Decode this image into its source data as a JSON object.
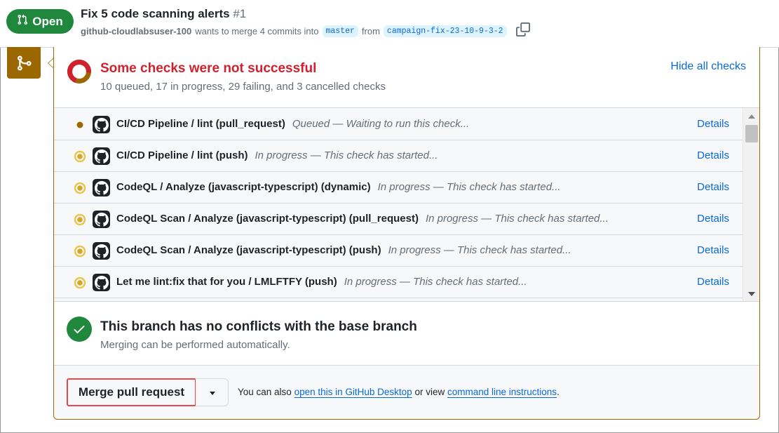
{
  "header": {
    "status_label": "Open",
    "title": "Fix 5 code scanning alerts",
    "number": "#1",
    "author": "github-cloudlabsuser-100",
    "merge_text": "wants to merge 4 commits into",
    "base_branch": "master",
    "from_text": "from",
    "head_branch": "campaign-fix-23-10-9-3-2"
  },
  "checks": {
    "title": "Some checks were not successful",
    "summary": "10 queued, 17 in progress, 29 failing, and 3 cancelled checks",
    "hide_label": "Hide all checks",
    "rows": [
      {
        "name": "CI/CD Pipeline / lint (pull_request)",
        "description": "Queued — Waiting to run this check...",
        "status": "queued",
        "details": "Details"
      },
      {
        "name": "CI/CD Pipeline / lint (push)",
        "description": "In progress — This check has started...",
        "status": "in-progress",
        "details": "Details"
      },
      {
        "name": "CodeQL / Analyze (javascript-typescript) (dynamic)",
        "description": "In progress — This check has started...",
        "status": "in-progress",
        "details": "Details"
      },
      {
        "name": "CodeQL Scan / Analyze (javascript-typescript) (pull_request)",
        "description": "In progress — This check has started...",
        "status": "in-progress",
        "details": "Details"
      },
      {
        "name": "CodeQL Scan / Analyze (javascript-typescript) (push)",
        "description": "In progress — This check has started...",
        "status": "in-progress",
        "details": "Details"
      },
      {
        "name": "Let me lint:fix that for you / LMLFTFY (push)",
        "description": "In progress — This check has started...",
        "status": "in-progress",
        "details": "Details"
      }
    ]
  },
  "merge": {
    "title": "This branch has no conflicts with the base branch",
    "subtitle": "Merging can be performed automatically.",
    "button_label": "Merge pull request",
    "hint_prefix": "You can also",
    "desktop_link": "open this in GitHub Desktop",
    "hint_middle": "or view",
    "cli_link": "command line instructions",
    "hint_suffix": "."
  },
  "colors": {
    "open_green": "#1f883d",
    "failure_red": "#cf222e",
    "pending_amber": "#9a6700",
    "link_blue": "#0969da",
    "highlight_red": "#e5484d"
  },
  "icons": {
    "status_badge": "git-pull-request-icon",
    "copy": "copy-icon",
    "side": "git-merge-icon",
    "checks_status": "status-ring-icon",
    "check_avatar": "github-mark-icon",
    "merge_ok": "check-circle-icon"
  }
}
